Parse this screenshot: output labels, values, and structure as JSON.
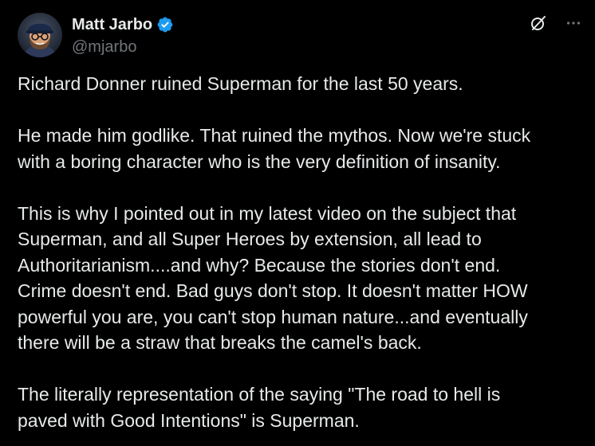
{
  "author": {
    "display_name": "Matt Jarbo",
    "handle": "@mjarbo",
    "verified": true,
    "avatar_icon": "avatar-photo",
    "verified_color": "#1d9bf0"
  },
  "actions": {
    "grok_icon": "grok-icon",
    "more_icon": "more-options-icon"
  },
  "tweet": {
    "paragraphs": [
      "Richard Donner ruined Superman for the last 50 years.",
      "He made him godlike. That ruined the mythos. Now we're stuck\nwith a boring character who is the very definition of insanity.",
      "This is why I pointed out in my latest video on the subject that\nSuperman, and all Super Heroes by extension, all lead to\nAuthoritarianism....and why? Because the stories don't end.\nCrime doesn't end. Bad guys don't stop. It doesn't matter HOW\npowerful you are, you can't stop human nature...and eventually\nthere will be a straw that breaks the camel's back.",
      "The literally representation of the saying \"The road to hell is\npaved with Good Intentions\" is Superman."
    ]
  },
  "colors": {
    "background": "#000000",
    "text": "#e7e9ea",
    "secondary_text": "#71767b"
  }
}
